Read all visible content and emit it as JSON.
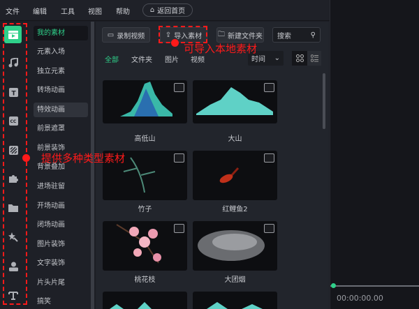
{
  "menu": [
    "文件",
    "编辑",
    "工具",
    "视图",
    "帮助"
  ],
  "home_button": "返回首页",
  "rail_icons": [
    "media-icon",
    "music-icon",
    "text-icon",
    "caption-icon",
    "filter-icon",
    "plugin-icon",
    "folder-icon",
    "effects-icon",
    "person-icon",
    "text-template-icon"
  ],
  "categories": [
    "我的素材",
    "元素入场",
    "独立元素",
    "转场动画",
    "特效动画",
    "前景遮罩",
    "前景装饰",
    "背景叠加",
    "进场驻留",
    "开场动画",
    "闭场动画",
    "图片装饰",
    "文字装饰",
    "片头片尾",
    "搞笑"
  ],
  "toolbar": {
    "record": "录制视频",
    "import": "导入素材",
    "new_folder": "新建文件夹",
    "search_placeholder": "搜索"
  },
  "tabs": [
    "全部",
    "文件夹",
    "图片",
    "视频"
  ],
  "sort": "时间",
  "items": [
    "高低山",
    "大山",
    "竹子",
    "红鲤鱼2",
    "桃花枝",
    "大团烟"
  ],
  "timecode": "00:00:00.00",
  "annotations": {
    "import": "可导入本地素材",
    "types": "提供多种类型素材"
  },
  "colors": {
    "accent": "#2fd08a",
    "annotation": "#ff1a1a"
  }
}
